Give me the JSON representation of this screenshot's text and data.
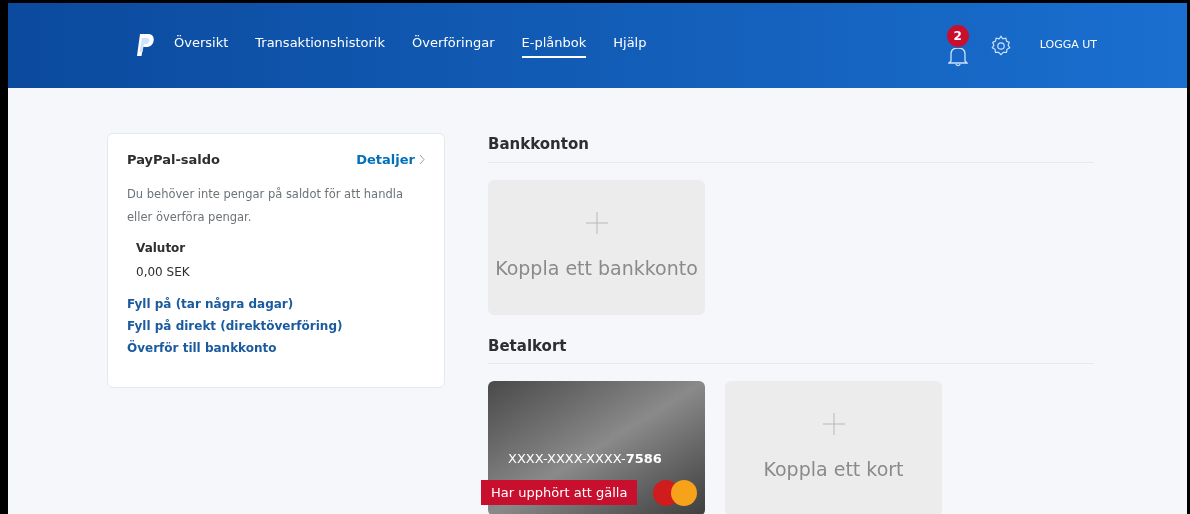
{
  "nav": {
    "items": [
      {
        "label": "Översikt",
        "selected": false
      },
      {
        "label": "Transaktionshistorik",
        "selected": false
      },
      {
        "label": "Överföringar",
        "selected": false
      },
      {
        "label": "E-plånbok",
        "selected": true
      },
      {
        "label": "Hjälp",
        "selected": false
      }
    ],
    "notification_count": "2",
    "logout": "LOGGA UT"
  },
  "balance": {
    "title": "PayPal-saldo",
    "details_link": "Detaljer",
    "description": "Du behöver inte pengar på saldot för att handla eller överföra pengar.",
    "currencies_label": "Valutor",
    "amount": "0,00 SEK",
    "links": [
      "Fyll på (tar några dagar)",
      "Fyll på direkt (direktöverföring)",
      "Överför till bankkonto"
    ]
  },
  "bank_accounts": {
    "title": "Bankkonton",
    "add_label": "Koppla ett bankkonto"
  },
  "cards": {
    "title": "Betalkort",
    "items": [
      {
        "number_masked": "XXXX-XXXX-XXXX-",
        "number_last": "7586",
        "expired": true,
        "status": "Har upphört att gälla"
      }
    ],
    "add_label": "Koppla ett kort"
  }
}
